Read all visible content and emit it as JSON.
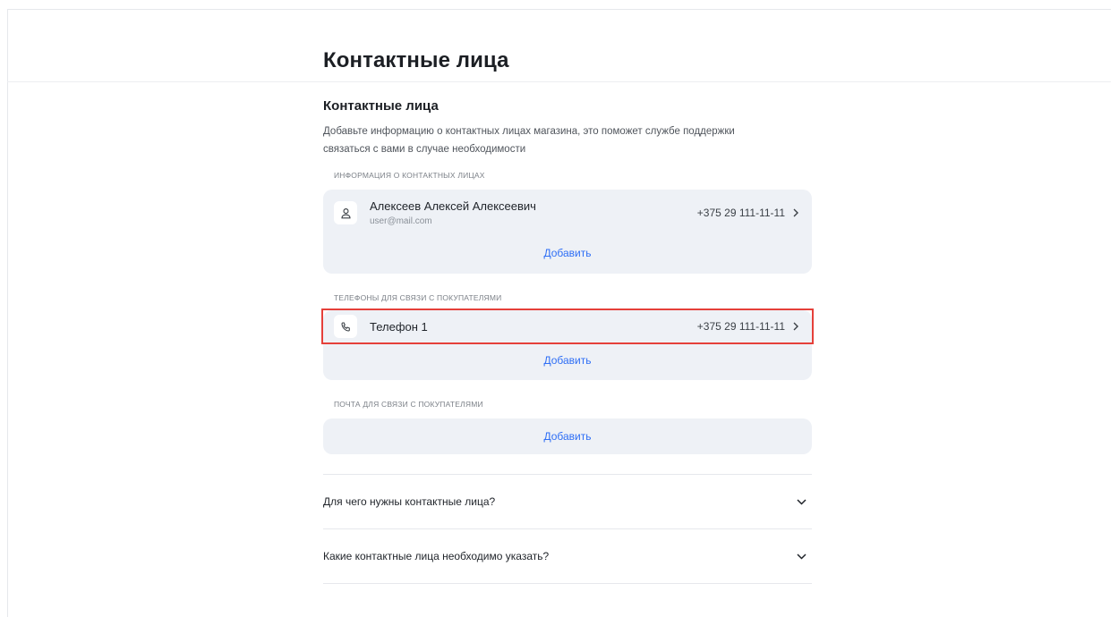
{
  "page": {
    "title": "Контактные лица"
  },
  "section": {
    "title": "Контактные лица",
    "description": "Добавьте информацию о контактных лицах магазина, это поможет службе поддержки связаться с вами в случае необходимости"
  },
  "contacts": {
    "label": "ИНФОРМАЦИЯ О КОНТАКТНЫХ ЛИЦАХ",
    "items": [
      {
        "name": "Алексеев Алексей Алексеевич",
        "email": "user@mail.com",
        "phone": "+375 29 111-11-11",
        "icon": "person-icon"
      }
    ],
    "add_label": "Добавить"
  },
  "phones": {
    "label": "ТЕЛЕФОНЫ ДЛЯ СВЯЗИ С ПОКУПАТЕЛЯМИ",
    "items": [
      {
        "name": "Телефон 1",
        "phone": "+375 29 111-11-11",
        "icon": "phone-icon"
      }
    ],
    "add_label": "Добавить"
  },
  "emails": {
    "label": "ПОЧТА ДЛЯ СВЯЗИ С ПОКУПАТЕЛЯМИ",
    "add_label": "Добавить"
  },
  "faq": [
    {
      "question": "Для чего нужны контактные лица?"
    },
    {
      "question": "Какие контактные лица необходимо указать?"
    }
  ],
  "colors": {
    "accent": "#2f6ff5",
    "card": "#eef1f6",
    "highlight": "#e5403a"
  }
}
